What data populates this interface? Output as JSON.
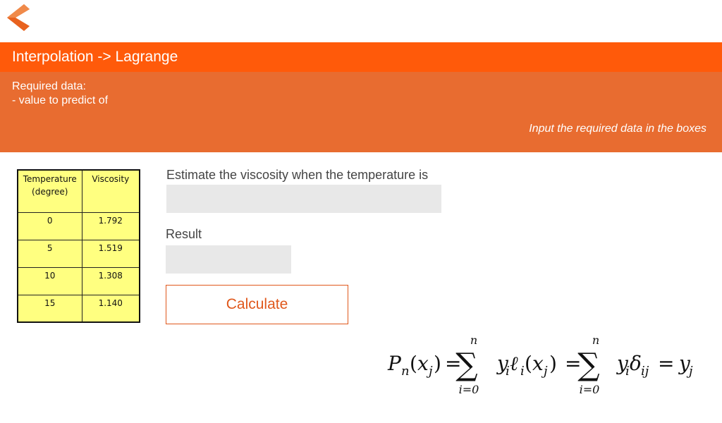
{
  "nav": {
    "back_icon": "chevron-left-icon",
    "back_color": "#e8621e"
  },
  "header": {
    "title": "Interpolation -> Lagrange",
    "color": "#ff5a0a"
  },
  "info": {
    "required_label": "Required data:",
    "required_items": [
      "- value to predict of"
    ],
    "hint": "Input the required data in the boxes",
    "color": "#e86c30"
  },
  "table": {
    "headers": [
      "Temperature\n(degree)",
      "Viscosity"
    ],
    "rows": [
      [
        "0",
        "1.792"
      ],
      [
        "5",
        "1.519"
      ],
      [
        "10",
        "1.308"
      ],
      [
        "15",
        "1.140"
      ]
    ],
    "background": "#ffff80"
  },
  "form": {
    "prompt": "Estimate the viscosity when the temperature is",
    "value_input": "",
    "result_label": "Result",
    "result_value": "",
    "calculate_label": "Calculate",
    "accent": "#e0581c"
  },
  "formula": {
    "lhs": "P",
    "lhs_sub": "n",
    "arg": "x",
    "arg_sub": "j",
    "sum_upper": "n",
    "sum_lower": "i=0",
    "term1_y": "y",
    "term1_y_sub": "i",
    "term1_l": "ℓ",
    "term1_l_sub": "i",
    "term2_y": "y",
    "term2_y_sub": "i",
    "term2_d": "δ",
    "term2_d_sub": "ij",
    "rhs": "y",
    "rhs_sub": "j"
  }
}
